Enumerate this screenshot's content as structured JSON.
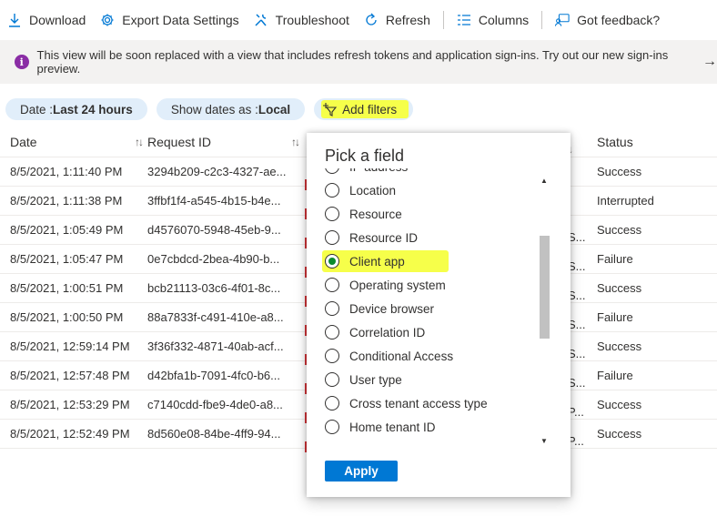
{
  "toolbar": {
    "download": "Download",
    "export": "Export Data Settings",
    "troubleshoot": "Troubleshoot",
    "refresh": "Refresh",
    "columns": "Columns",
    "feedback": "Got feedback?"
  },
  "banner": {
    "text": "This view will be soon replaced with a view that includes refresh tokens and application sign-ins. Try out our new sign-ins preview.",
    "arrow": "→"
  },
  "filters": {
    "date_label": "Date : ",
    "date_value": "Last 24 hours",
    "show_label": "Show dates as : ",
    "show_value": "Local",
    "add": "Add filters"
  },
  "table": {
    "headers": {
      "date": "Date",
      "request": "Request ID",
      "status": "Status"
    },
    "rows": [
      {
        "date": "8/5/2021, 1:11:40 PM",
        "req": "3294b209-c2c3-4327-ae...",
        "extra": "",
        "status": "Success"
      },
      {
        "date": "8/5/2021, 1:11:38 PM",
        "req": "3ffbf1f4-a545-4b15-b4e...",
        "extra": "",
        "status": "Interrupted"
      },
      {
        "date": "8/5/2021, 1:05:49 PM",
        "req": "d4576070-5948-45eb-9...",
        "extra": "S...",
        "status": "Success"
      },
      {
        "date": "8/5/2021, 1:05:47 PM",
        "req": "0e7cbdcd-2bea-4b90-b...",
        "extra": "S...",
        "status": "Failure"
      },
      {
        "date": "8/5/2021, 1:00:51 PM",
        "req": "bcb21113-03c6-4f01-8c...",
        "extra": "S...",
        "status": "Success"
      },
      {
        "date": "8/5/2021, 1:00:50 PM",
        "req": "88a7833f-c491-410e-a8...",
        "extra": "S...",
        "status": "Failure"
      },
      {
        "date": "8/5/2021, 12:59:14 PM",
        "req": "3f36f332-4871-40ab-acf...",
        "extra": "S...",
        "status": "Success"
      },
      {
        "date": "8/5/2021, 12:57:48 PM",
        "req": "d42bfa1b-7091-4fc0-b6...",
        "extra": "S...",
        "status": "Failure"
      },
      {
        "date": "8/5/2021, 12:53:29 PM",
        "req": "c7140cdd-fbe9-4de0-a8...",
        "extra": "P...",
        "status": "Success"
      },
      {
        "date": "8/5/2021, 12:52:49 PM",
        "req": "8d560e08-84be-4ff9-94...",
        "extra": "P...",
        "status": "Success"
      }
    ]
  },
  "dialog": {
    "title": "Pick a field",
    "options": [
      {
        "label": "IP address",
        "selected": false
      },
      {
        "label": "Location",
        "selected": false
      },
      {
        "label": "Resource",
        "selected": false
      },
      {
        "label": "Resource ID",
        "selected": false
      },
      {
        "label": "Client app",
        "selected": true
      },
      {
        "label": "Operating system",
        "selected": false
      },
      {
        "label": "Device browser",
        "selected": false
      },
      {
        "label": "Correlation ID",
        "selected": false
      },
      {
        "label": "Conditional Access",
        "selected": false
      },
      {
        "label": "User type",
        "selected": false
      },
      {
        "label": "Cross tenant access type",
        "selected": false
      },
      {
        "label": "Home tenant ID",
        "selected": false
      }
    ],
    "apply": "Apply"
  },
  "colors": {
    "accent": "#0078d4",
    "highlight": "#f6ff4a",
    "banner_icon": "#8a2da5",
    "pill_bg": "#e1eefa"
  }
}
